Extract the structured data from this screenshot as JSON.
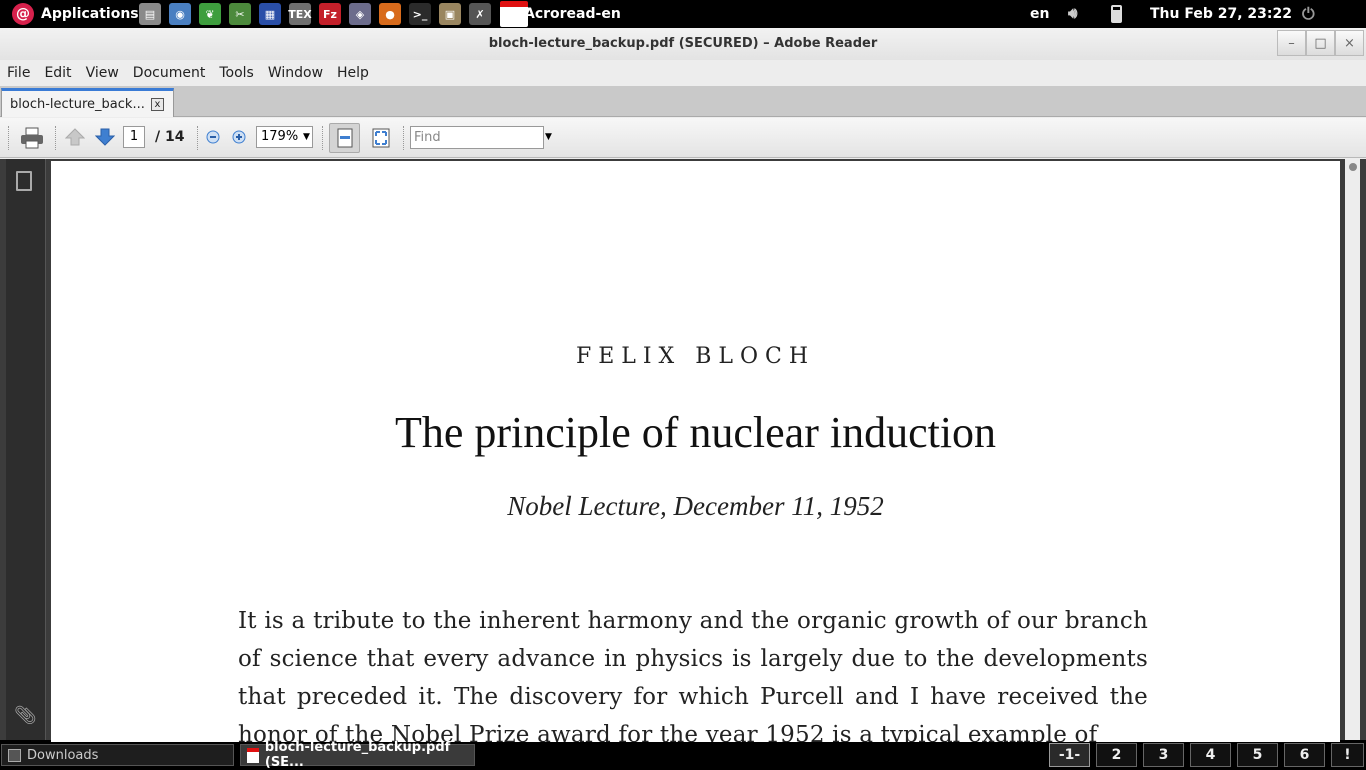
{
  "top_panel": {
    "applications_label": "Applications",
    "launchers": [
      {
        "icon": "files-icon",
        "glyph": "▤",
        "color": "#8a8a8a"
      },
      {
        "icon": "chromium-icon",
        "glyph": "◉",
        "color": "#4a7fc1"
      },
      {
        "icon": "leaf-icon",
        "glyph": "❦",
        "color": "#3e9e3e"
      },
      {
        "icon": "tools-icon",
        "glyph": "✂",
        "color": "#4c8a3c"
      },
      {
        "icon": "calendar-grid-icon",
        "glyph": "▦",
        "color": "#2a4fa8"
      },
      {
        "icon": "tex-icon",
        "glyph": "TEX",
        "color": "#6f6f6f"
      },
      {
        "icon": "filezilla-icon",
        "glyph": "Fz",
        "color": "#c4202a"
      },
      {
        "icon": "image-viewer-icon",
        "glyph": "◈",
        "color": "#6c6c8c"
      },
      {
        "icon": "firefox-icon",
        "glyph": "●",
        "color": "#d86b1c"
      },
      {
        "icon": "terminal-icon",
        "glyph": ">_",
        "color": "#2b2b2b"
      },
      {
        "icon": "archive-icon",
        "glyph": "▣",
        "color": "#9a8660"
      },
      {
        "icon": "xterm-icon",
        "glyph": "✗",
        "color": "#555555"
      }
    ],
    "active_app_label": "Acroread-en",
    "language": "en",
    "clock": "Thu Feb 27, 23:22"
  },
  "window": {
    "title": "bloch-lecture_backup.pdf (SECURED) – Adobe Reader",
    "controls": {
      "minimize": "–",
      "maximize": "□",
      "close": "×"
    }
  },
  "menubar": [
    "File",
    "Edit",
    "View",
    "Document",
    "Tools",
    "Window",
    "Help"
  ],
  "tab": {
    "label": "bloch-lecture_back...",
    "close": "x"
  },
  "toolbar": {
    "page_current": "1",
    "page_total": "/  14",
    "zoom": "179%",
    "find_placeholder": "Find"
  },
  "document": {
    "author": "FELIX BLOCH",
    "title": "The principle of nuclear induction",
    "subtitle": "Nobel Lecture, December 11, 1952",
    "body": "It is a tribute to the inherent harmony and the organic growth of our branch of science that every advance in physics is largely due to the developments that preceded it. The discovery for which Purcell and I have received the honor of the Nobel Prize award for the year 1952 is a typical example of"
  },
  "taskbar": {
    "tasks": [
      "Downloads",
      "bloch-lecture_backup.pdf (SE..."
    ],
    "workspaces": [
      "-1-",
      "2",
      "3",
      "4",
      "5",
      "6",
      "!"
    ]
  },
  "colors": {
    "accent": "#3a7bd5",
    "debian_red": "#d7214c",
    "acrobat_red": "#e01010"
  }
}
